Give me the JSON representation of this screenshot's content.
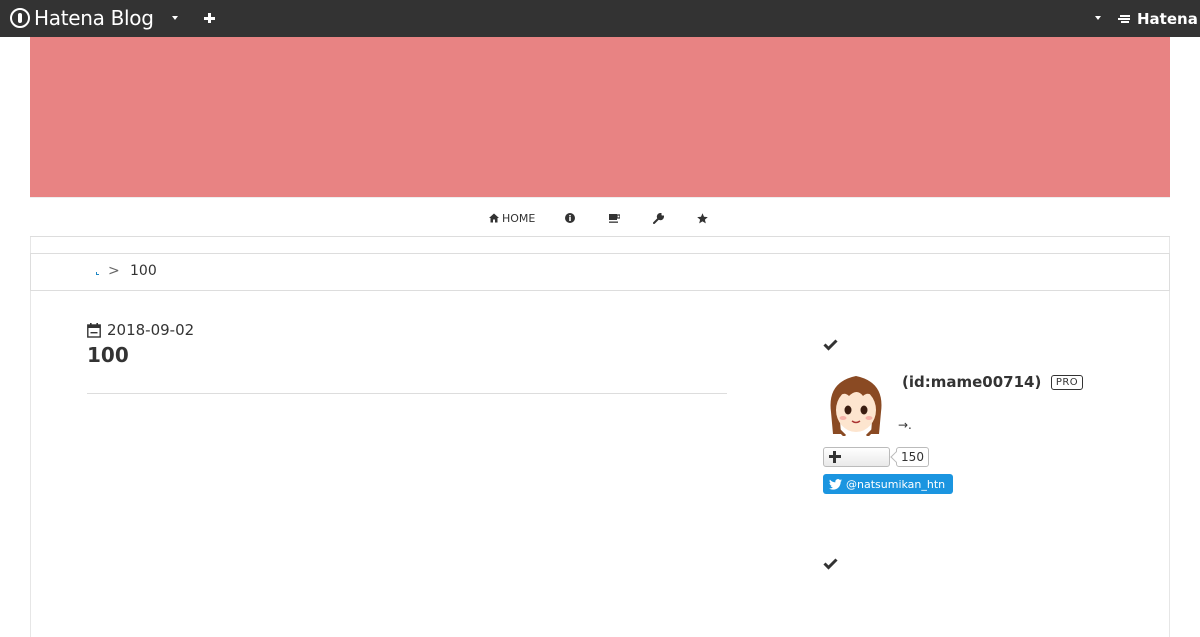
{
  "global_header": {
    "logo_text": "Hatena Blog",
    "brand_text": "Hatena",
    "icons": [
      "hatena-blog-logo-icon",
      "chevron-down-icon",
      "plus-icon",
      "hatena-logo-icon"
    ]
  },
  "theme": {
    "banner_color": "#e88383",
    "header_bg": "#333333",
    "link_color": "#1f87c4",
    "twitter_color": "#1b95e0"
  },
  "global_nav": {
    "items": [
      {
        "icon": "home-icon",
        "label": "HOME"
      },
      {
        "icon": "info-icon",
        "label": ""
      },
      {
        "icon": "coffee-icon",
        "label": ""
      },
      {
        "icon": "wrench-icon",
        "label": ""
      },
      {
        "icon": "star-icon",
        "label": ""
      }
    ]
  },
  "breadcrumb": {
    "home": "",
    "separator": ">",
    "current": "100"
  },
  "entry": {
    "date": "2018-09-02",
    "title": "100"
  },
  "sidebar": {
    "profile": {
      "id_text": "(id:mame00714)",
      "badge": "PRO",
      "description": "→."
    },
    "subscribe": {
      "count": "150"
    },
    "twitter": {
      "handle": "@natsumikan_htn"
    }
  }
}
